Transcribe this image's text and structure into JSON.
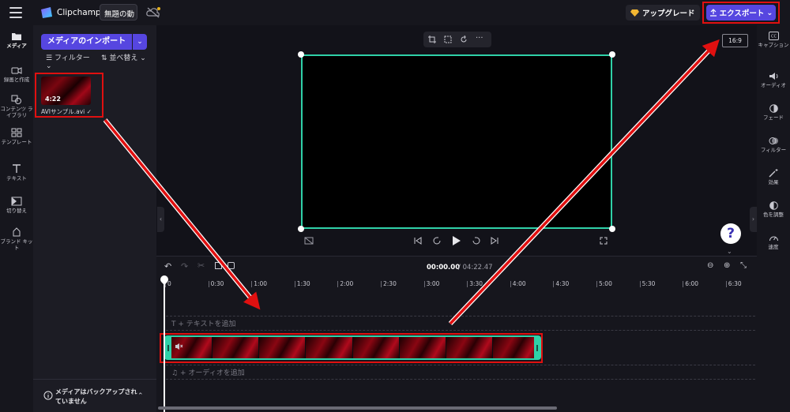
{
  "topbar": {
    "brand": "Clipchamp",
    "project_title": "無題の動",
    "upgrade_label": "アップグレード",
    "export_label": "エクスポート"
  },
  "left_nav": {
    "items": [
      {
        "label": "メディア",
        "icon": "folder-icon"
      },
      {
        "label": "録画と作成",
        "icon": "camera-icon"
      },
      {
        "label": "コンテンツ ライブラリ",
        "icon": "shapes-icon"
      },
      {
        "label": "テンプレート",
        "icon": "grid-icon"
      },
      {
        "label": "テキスト",
        "icon": "text-icon"
      },
      {
        "label": "切り替え",
        "icon": "transition-icon"
      },
      {
        "label": "ブランド キット",
        "icon": "brand-icon"
      }
    ]
  },
  "media_panel": {
    "import_label": "メディアのインポート",
    "filter_label": "フィルター",
    "sort_label": "並べ替え",
    "item": {
      "name": "AVIサンプル.avi",
      "duration": "4:22"
    },
    "backup_notice": "メディアはバックアップされていません"
  },
  "preview": {
    "aspect_ratio": "16:9",
    "help_label": "?"
  },
  "right_nav": {
    "items": [
      {
        "label": "キャプション",
        "icon": "cc-icon"
      },
      {
        "label": "オーディオ",
        "icon": "speaker-icon"
      },
      {
        "label": "フェード",
        "icon": "fade-icon"
      },
      {
        "label": "フィルター",
        "icon": "filter-icon"
      },
      {
        "label": "効果",
        "icon": "wand-icon"
      },
      {
        "label": "色を調整",
        "icon": "contrast-icon"
      },
      {
        "label": "速度",
        "icon": "speed-icon"
      }
    ]
  },
  "timeline": {
    "current_time": "00:00.00",
    "total_time": "/ 04:22.47",
    "ruler": [
      "0",
      "0:30",
      "1:00",
      "1:30",
      "2:00",
      "2:30",
      "3:00",
      "3:30",
      "4:00",
      "4:30",
      "5:00",
      "5:30",
      "6:00",
      "6:30"
    ],
    "add_text_label": "+ テキストを追加",
    "add_audio_label": "+ オーディオを追加"
  },
  "colors": {
    "accent": "#5646e0",
    "selection": "#2fd1a8",
    "annotation": "#e01010"
  }
}
